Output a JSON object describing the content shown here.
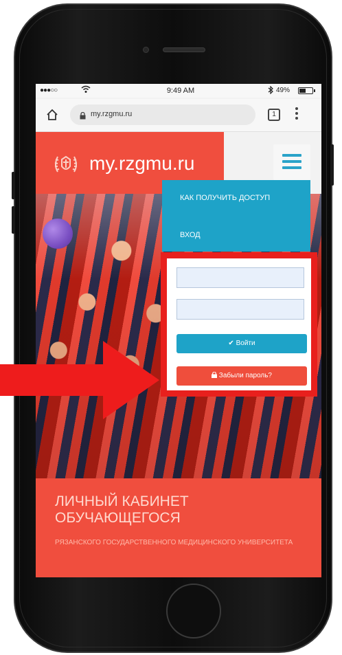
{
  "statusbar": {
    "signal": "●●●○○",
    "wifi": "wifi-icon",
    "time": "9:49 AM",
    "bluetooth": "bluetooth-icon",
    "battery_percent": "49%"
  },
  "browser": {
    "url": "my.rzgmu.ru",
    "tabs_count": "1"
  },
  "site": {
    "title": "my.rzgmu.ru",
    "accent_color": "#f04e3e",
    "menu_color": "#1ea3c8"
  },
  "menu": {
    "items": [
      {
        "label": "КАК ПОЛУЧИТЬ ДОСТУП"
      },
      {
        "label": "ВХОД"
      }
    ]
  },
  "login": {
    "username_placeholder": "",
    "password_placeholder": "",
    "login_button": "Войти",
    "forgot_button": "Забыли пароль?"
  },
  "banner": {
    "title": "ЛИЧНЫЙ КАБИНЕТ ОБУЧАЮЩЕГОСЯ",
    "subtitle": "РЯЗАНСКОГО ГОСУДАРСТВЕННОГО МЕДИЦИНСКОГО УНИВЕРСИТЕТА"
  }
}
